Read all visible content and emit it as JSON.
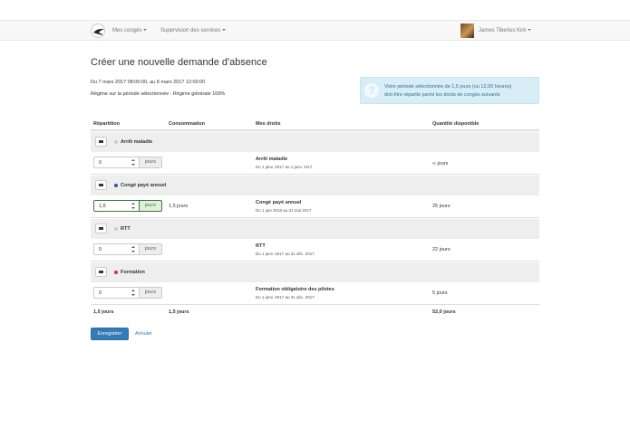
{
  "navbar": {
    "menu_conges": "Mes congés",
    "menu_supervision": "Supervision des services",
    "user_name": "James Tiberius Kirk"
  },
  "page": {
    "title": "Créer une nouvelle demande d'absence",
    "period": "Du 7 mars 2017 08:00:00, au 8 mars 2017 12:00:00",
    "regime": "Régime sur la période sélectionnée : Régime générale 100%"
  },
  "alert": {
    "line1": "Votre période sélectionnée de 1,5 jours (ou 12,00 heures)",
    "line2": "doit être répartie parmi les droits de congés suivants"
  },
  "table": {
    "headers": [
      "Répartition",
      "Consommation",
      "Mes droits",
      "Quantité disponible"
    ],
    "unit": "jours",
    "groups": [
      {
        "name": "Arrêt maladie",
        "color": "#cccccc",
        "input": "0",
        "consumption": "",
        "right_name": "Arrêt maladie",
        "right_period": "Du 1 janv. 2017 au 1 janv. 2117",
        "available": "∞ jours"
      },
      {
        "name": "Congé payé annuel",
        "color": "#3355aa",
        "input": "1,5",
        "consumption": "1,5 jours",
        "right_name": "Congé payé annuel",
        "right_period": "Du 1 juin 2016 au 31 mai 2017",
        "available": "25 jours"
      },
      {
        "name": "RTT",
        "color": "#cccccc",
        "input": "0",
        "consumption": "",
        "right_name": "RTT",
        "right_period": "Du 1 janv. 2017 au 31 déc. 2017",
        "available": "22 jours"
      },
      {
        "name": "Formation",
        "color": "#cc3355",
        "input": "0",
        "consumption": "",
        "right_name": "Formation obligatoire des pilotes",
        "right_period": "Du 1 janv. 2017 au 31 déc. 2017",
        "available": "5 jours"
      }
    ],
    "totals": {
      "repartition": "1,5 jours",
      "consumption": "1,5 jours",
      "available": "52,0 jours"
    }
  },
  "actions": {
    "save": "Enregistrer",
    "cancel": "Annuler"
  }
}
